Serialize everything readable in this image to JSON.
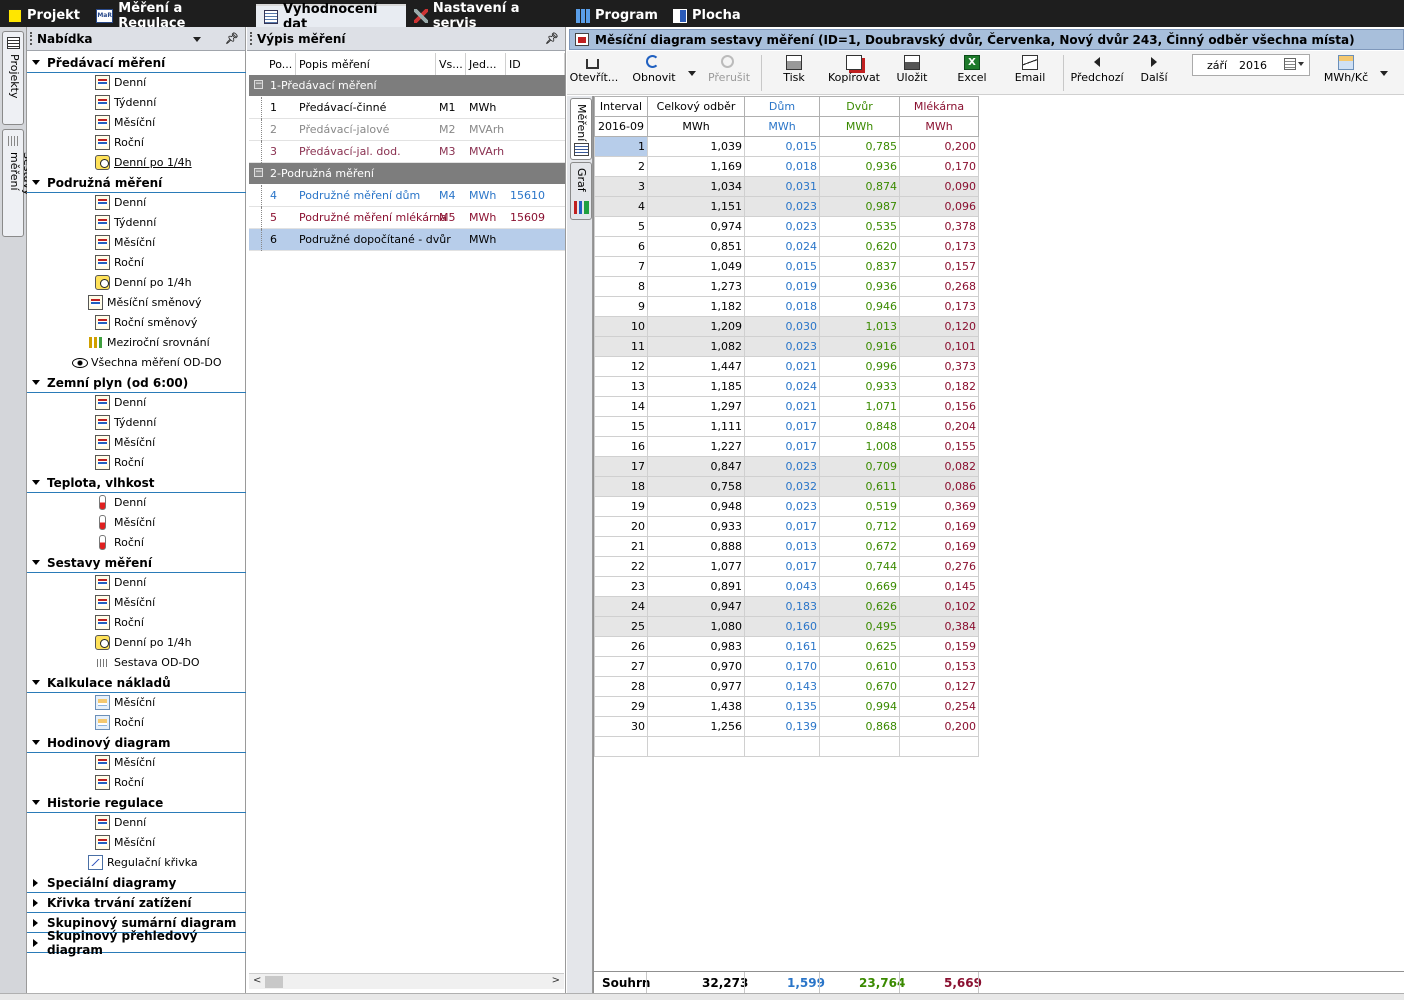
{
  "top_tabs": [
    {
      "label": "Projekt",
      "icon": "project-icon"
    },
    {
      "label": "Měření a Regulace",
      "icon": "mar-icon"
    },
    {
      "label": "Vyhodnocení dat",
      "icon": "table-icon",
      "active": true
    },
    {
      "label": "Nastavení a servis",
      "icon": "tools-icon"
    },
    {
      "label": "Program",
      "icon": "bar-chart-icon"
    },
    {
      "label": "Plocha",
      "icon": "desktop-icon"
    }
  ],
  "left_strip": {
    "tab1": "Projekty",
    "tab2": "Sestavy měření"
  },
  "menu": {
    "title": "Nabídka",
    "groups": [
      {
        "label": "Předávací měření",
        "items": [
          "Denní",
          "Týdenní",
          "Měsíční",
          "Roční",
          "Denní po 1/4h"
        ]
      },
      {
        "label": "Podružná měření",
        "items": [
          "Denní",
          "Týdenní",
          "Měsíční",
          "Roční",
          "Denní po 1/4h",
          "Měsíční směnový",
          "Roční směnový",
          "Meziroční srovnání",
          "Všechna měření OD-DO"
        ]
      },
      {
        "label": "Zemní plyn (od 6:00)",
        "items": [
          "Denní",
          "Týdenní",
          "Měsíční",
          "Roční"
        ]
      },
      {
        "label": "Teplota, vlhkost",
        "items": [
          "Denní",
          "Měsíční",
          "Roční"
        ]
      },
      {
        "label": "Sestavy měření",
        "items": [
          "Denní",
          "Měsíční",
          "Roční",
          "Denní po 1/4h",
          "Sestava OD-DO"
        ]
      },
      {
        "label": "Kalkulace nákladů",
        "items": [
          "Měsíční",
          "Roční"
        ]
      },
      {
        "label": "Hodinový diagram",
        "items": [
          "Měsíční",
          "Roční"
        ]
      },
      {
        "label": "Historie regulace",
        "items": [
          "Denní",
          "Měsíční",
          "Regulační křivka"
        ]
      },
      {
        "label": "Speciální diagramy"
      },
      {
        "label": "Křivka trvání zatížení"
      },
      {
        "label": "Skupinový sumární diagram"
      },
      {
        "label": "Skupinový přehledový diagram"
      }
    ]
  },
  "list": {
    "title": "Výpis měření",
    "headers": [
      "Po...",
      "Popis měření",
      "Vs...",
      "Jed...",
      "ID"
    ],
    "group1": "1-Předávací měření",
    "group2": "2-Podružná měření",
    "rows": [
      {
        "no": "1",
        "desc": "Předávací-činné",
        "vs": "M1",
        "unit": "MWh",
        "id": ""
      },
      {
        "no": "2",
        "desc": "Předávací-jalové",
        "vs": "M2",
        "unit": "MVArh",
        "id": ""
      },
      {
        "no": "3",
        "desc": "Předávací-jal. dod.",
        "vs": "M3",
        "unit": "MVArh",
        "id": ""
      },
      {
        "no": "4",
        "desc": "Podružné měření dům",
        "vs": "M4",
        "unit": "MWh",
        "id": "15610"
      },
      {
        "no": "5",
        "desc": "Podružné měření mlékárna",
        "vs": "M5",
        "unit": "MWh",
        "id": "15609"
      },
      {
        "no": "6",
        "desc": "Podružné dopočítané - dvůr",
        "vs": "",
        "unit": "MWh",
        "id": ""
      }
    ]
  },
  "main": {
    "title": "Měsíční diagram sestavy měření (ID=1, Doubravský dvůr, Červenka, Nový dvůr 243, Činný odběr všechna místa)",
    "toolbar": {
      "open": "Otevřít...",
      "refresh": "Obnovit",
      "interrupt": "Přerušit",
      "print": "Tisk",
      "copy": "Kopírovat",
      "save": "Uložit",
      "excel": "Excel",
      "email": "Email",
      "prev": "Předchozí",
      "next": "Další",
      "month": "září",
      "year": "2016",
      "units": "MWh/Kč"
    },
    "side_tabs": [
      "Měření",
      "Graf"
    ],
    "colors": {
      "dum": "#2a75c8",
      "dvur": "#3a8a00",
      "mlekarna": "#8a1030",
      "selection": "#b7cdea"
    }
  },
  "table": {
    "headers": [
      "Interval",
      "Celkový odběr",
      "Dům",
      "Dvůr",
      "Mlékárna"
    ],
    "subheaders": [
      "2016-09",
      "MWh",
      "MWh",
      "MWh",
      "MWh"
    ],
    "rows": [
      [
        "1",
        "1,039",
        "0,015",
        "0,785",
        "0,200"
      ],
      [
        "2",
        "1,169",
        "0,018",
        "0,936",
        "0,170"
      ],
      [
        "3",
        "1,034",
        "0,031",
        "0,874",
        "0,090"
      ],
      [
        "4",
        "1,151",
        "0,023",
        "0,987",
        "0,096"
      ],
      [
        "5",
        "0,974",
        "0,023",
        "0,535",
        "0,378"
      ],
      [
        "6",
        "0,851",
        "0,024",
        "0,620",
        "0,173"
      ],
      [
        "7",
        "1,049",
        "0,015",
        "0,837",
        "0,157"
      ],
      [
        "8",
        "1,273",
        "0,019",
        "0,936",
        "0,268"
      ],
      [
        "9",
        "1,182",
        "0,018",
        "0,946",
        "0,173"
      ],
      [
        "10",
        "1,209",
        "0,030",
        "1,013",
        "0,120"
      ],
      [
        "11",
        "1,082",
        "0,023",
        "0,916",
        "0,101"
      ],
      [
        "12",
        "1,447",
        "0,021",
        "0,996",
        "0,373"
      ],
      [
        "13",
        "1,185",
        "0,024",
        "0,933",
        "0,182"
      ],
      [
        "14",
        "1,297",
        "0,021",
        "1,071",
        "0,156"
      ],
      [
        "15",
        "1,111",
        "0,017",
        "0,848",
        "0,204"
      ],
      [
        "16",
        "1,227",
        "0,017",
        "1,008",
        "0,155"
      ],
      [
        "17",
        "0,847",
        "0,023",
        "0,709",
        "0,082"
      ],
      [
        "18",
        "0,758",
        "0,032",
        "0,611",
        "0,086"
      ],
      [
        "19",
        "0,948",
        "0,023",
        "0,519",
        "0,369"
      ],
      [
        "20",
        "0,933",
        "0,017",
        "0,712",
        "0,169"
      ],
      [
        "21",
        "0,888",
        "0,013",
        "0,672",
        "0,169"
      ],
      [
        "22",
        "1,077",
        "0,017",
        "0,744",
        "0,276"
      ],
      [
        "23",
        "0,891",
        "0,043",
        "0,669",
        "0,145"
      ],
      [
        "24",
        "0,947",
        "0,183",
        "0,626",
        "0,102"
      ],
      [
        "25",
        "1,080",
        "0,160",
        "0,495",
        "0,384"
      ],
      [
        "26",
        "0,983",
        "0,161",
        "0,625",
        "0,159"
      ],
      [
        "27",
        "0,970",
        "0,170",
        "0,610",
        "0,153"
      ],
      [
        "28",
        "0,977",
        "0,143",
        "0,670",
        "0,127"
      ],
      [
        "29",
        "1,438",
        "0,135",
        "0,994",
        "0,254"
      ],
      [
        "30",
        "1,256",
        "0,139",
        "0,868",
        "0,200"
      ]
    ],
    "weekend_rows": [
      3,
      4,
      10,
      11,
      17,
      18,
      24,
      25
    ],
    "summary": {
      "label": "Souhrn",
      "total": "32,273",
      "dum": "1,599",
      "dvur": "23,764",
      "mlekarna": "5,669"
    }
  }
}
